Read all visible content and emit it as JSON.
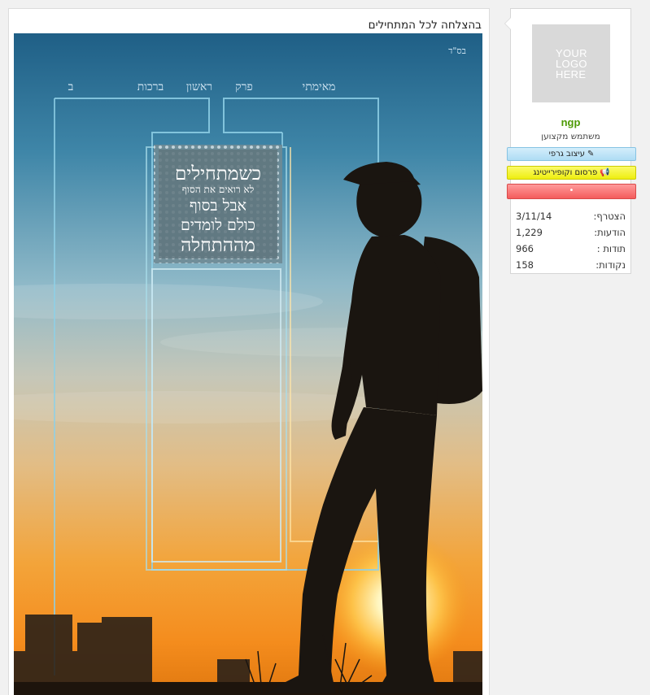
{
  "post": {
    "title": "בהצלחה לכל המתחילים",
    "poster": {
      "corner": "בס\"ד",
      "header_words": [
        "מאימתי",
        "פרק",
        "ראשון",
        "ברכות",
        "ב"
      ],
      "quote_lines": [
        "כשמתחילים",
        "לא רואים את הסוף",
        "אבל בסוף",
        "כולם לומדים",
        "מההתחלה"
      ]
    }
  },
  "user": {
    "logo_text": [
      "YOUR",
      "LOGO",
      "HERE"
    ],
    "name": "ngp",
    "title": "משתמש מקצוען",
    "badges": [
      {
        "label": "עיצוב גרפי",
        "icon": "pencil-icon"
      },
      {
        "label": "פרסום וקופירייטינג",
        "icon": "megaphone-icon"
      },
      {
        "label": "•"
      }
    ],
    "stats": [
      {
        "label": "הצטרף:",
        "value": "3/11/14"
      },
      {
        "label": "הודעות:",
        "value": "1,229"
      },
      {
        "label": "תודות :",
        "value": "966"
      },
      {
        "label": "נקודות:",
        "value": "158"
      }
    ]
  },
  "colors": {
    "username": "#4e9a06",
    "badge_blue": "#aedcf4",
    "badge_yellow": "#eeee10",
    "badge_red": "#f45c5c"
  }
}
